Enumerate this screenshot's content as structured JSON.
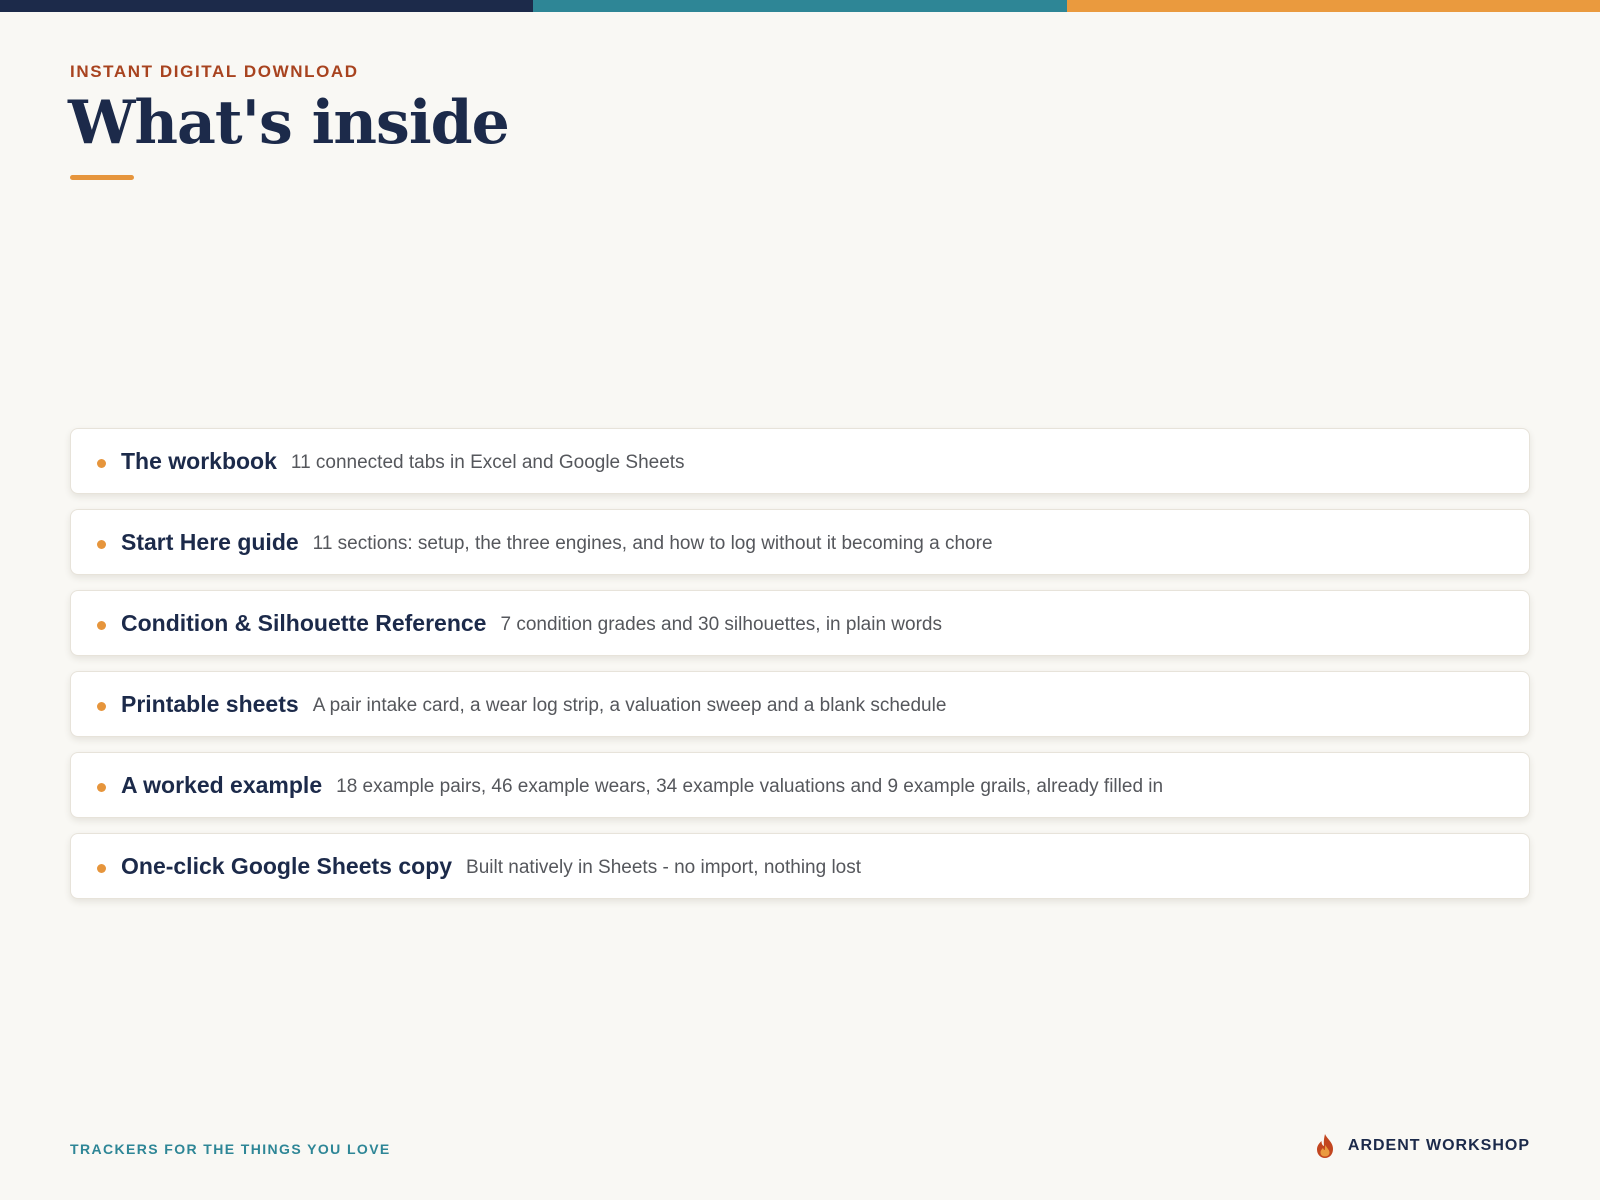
{
  "header": {
    "eyebrow": "INSTANT DIGITAL DOWNLOAD",
    "title": "What's inside"
  },
  "colors": {
    "navy": "#1c2a4a",
    "teal": "#2e8696",
    "orange": "#ea9a3e",
    "rust": "#a8431f",
    "background": "#f9f8f4"
  },
  "items": [
    {
      "name": "The workbook",
      "description": "11 connected tabs in Excel and Google Sheets"
    },
    {
      "name": "Start Here guide",
      "description": "11 sections: setup, the three engines, and how to log without it becoming a chore"
    },
    {
      "name": "Condition & Silhouette Reference",
      "description": "7 condition grades and 30 silhouettes, in plain words"
    },
    {
      "name": "Printable sheets",
      "description": "A pair intake card, a wear log strip, a valuation sweep and a blank schedule"
    },
    {
      "name": "A worked example",
      "description": "18 example pairs, 46 example wears, 34 example valuations and 9 example grails, already filled in"
    },
    {
      "name": "One-click Google Sheets copy",
      "description": "Built natively in Sheets - no import, nothing lost"
    }
  ],
  "footer": {
    "tagline": "TRACKERS FOR THE THINGS YOU LOVE",
    "brand_name": "ARDENT WORKSHOP",
    "brand_icon": "flame-logo-icon"
  }
}
